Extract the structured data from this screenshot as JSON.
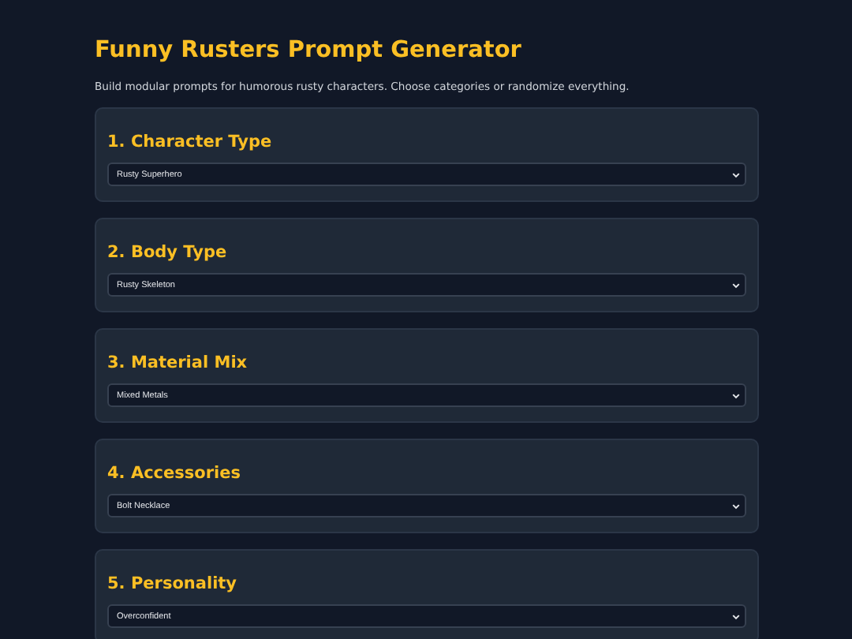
{
  "title": "Funny Rusters Prompt Generator",
  "subtitle": "Build modular prompts for humorous rusty characters. Choose categories or randomize everything.",
  "sections": [
    {
      "heading": "1. Character Type",
      "value": "Rusty Superhero"
    },
    {
      "heading": "2. Body Type",
      "value": "Rusty Skeleton"
    },
    {
      "heading": "3. Material Mix",
      "value": "Mixed Metals"
    },
    {
      "heading": "4. Accessories",
      "value": "Bolt Necklace"
    },
    {
      "heading": "5. Personality",
      "value": "Overconfident"
    }
  ]
}
